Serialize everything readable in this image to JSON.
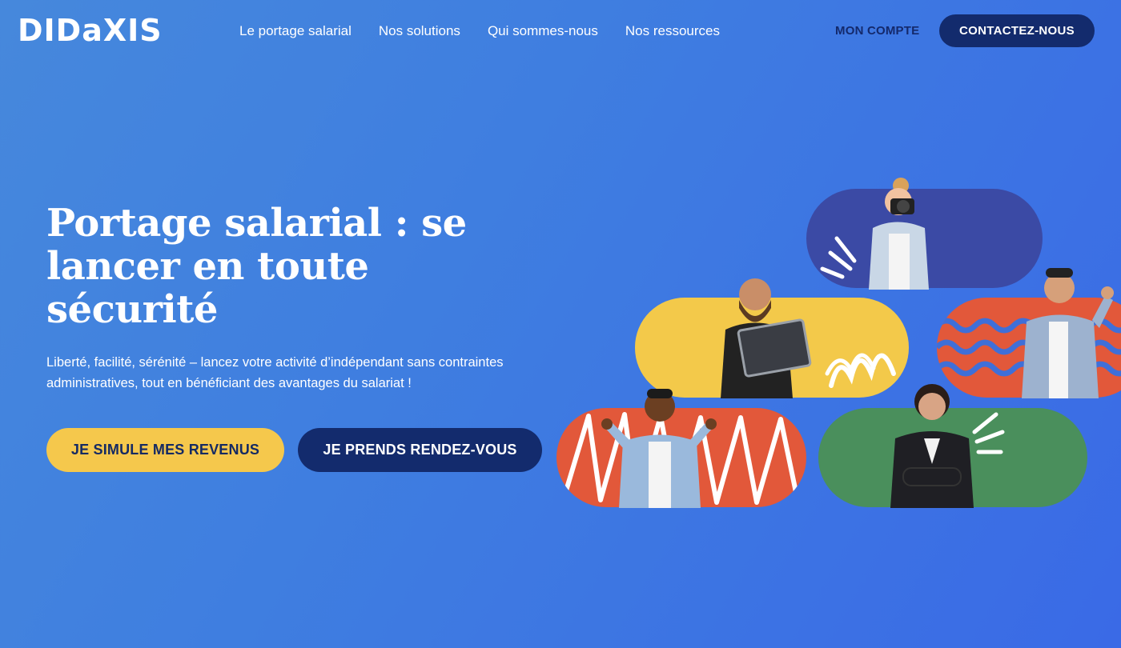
{
  "brand": {
    "logo_text": "DIDaXIS"
  },
  "nav": {
    "items": [
      "Le portage salarial",
      "Nos solutions",
      "Qui sommes-nous",
      "Nos ressources"
    ],
    "account_label": "MON COMPTE",
    "contact_label": "CONTACTEZ-NOUS"
  },
  "hero": {
    "title": "Portage salarial : se lancer en toute sécurité",
    "subtitle": "Liberté, facilité, sérénité – lancez votre activité d’indépendant sans contraintes administratives, tout en bénéficiant des avantages du salariat !",
    "cta_primary": "JE SIMULE MES REVENUS",
    "cta_secondary": "JE PRENDS RENDEZ-VOUS"
  },
  "colors": {
    "background": "#4285dc",
    "navy": "#132b6d",
    "yellow": "#f5c84c",
    "purple": "#3b4aa5",
    "orange": "#e2583a",
    "green": "#4a8f5c"
  },
  "illustration": {
    "people": [
      "photographer-woman",
      "bearded-man-laptop",
      "man-blazer-fist",
      "man-celebrating",
      "businesswoman-arms-crossed"
    ]
  }
}
